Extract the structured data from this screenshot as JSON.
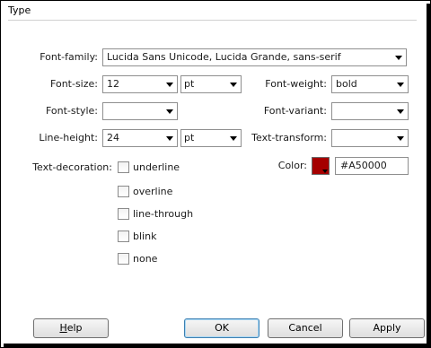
{
  "section": {
    "title": "Type"
  },
  "fields": {
    "font_family": {
      "label": "Font-family:",
      "value": "Lucida Sans Unicode, Lucida Grande, sans-serif"
    },
    "font_size": {
      "label": "Font-size:",
      "value": "12",
      "unit": "pt"
    },
    "font_weight": {
      "label": "Font-weight:",
      "value": "bold"
    },
    "font_style": {
      "label": "Font-style:",
      "value": ""
    },
    "font_variant": {
      "label": "Font-variant:",
      "value": ""
    },
    "line_height": {
      "label": "Line-height:",
      "value": "24",
      "unit": "pt"
    },
    "text_transform": {
      "label": "Text-transform:",
      "value": ""
    },
    "color": {
      "label": "Color:",
      "value": "#A50000",
      "swatch": "#A50000"
    }
  },
  "text_decoration": {
    "label": "Text-decoration:",
    "options": [
      {
        "label": "underline",
        "checked": false
      },
      {
        "label": "overline",
        "checked": false
      },
      {
        "label": "line-through",
        "checked": false
      },
      {
        "label": "blink",
        "checked": false
      },
      {
        "label": "none",
        "checked": false
      }
    ]
  },
  "buttons": {
    "help_first": "H",
    "help_rest": "elp",
    "ok": "OK",
    "cancel": "Cancel",
    "apply": "Apply"
  }
}
